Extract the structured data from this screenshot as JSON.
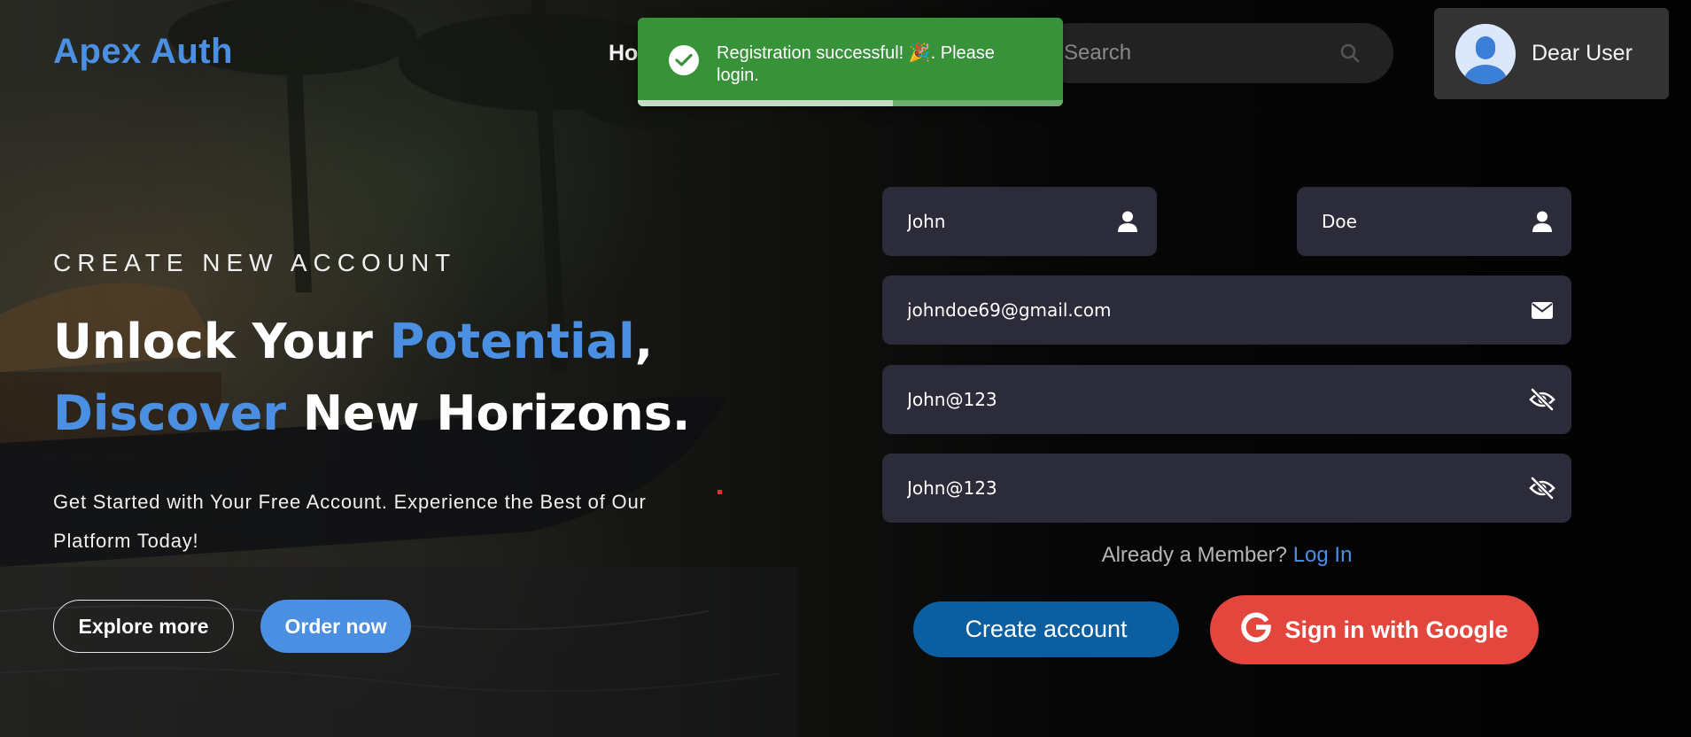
{
  "header": {
    "brand": "Apex Auth",
    "nav_home": "Ho",
    "search_placeholder": "Search",
    "user_name": "Dear User"
  },
  "toast": {
    "message": "Registration successful! 🎉. Please login.",
    "type": "success",
    "color": "#37923a",
    "progress": 0.6
  },
  "hero": {
    "eyebrow": "CREATE NEW ACCOUNT",
    "headline": {
      "line1_a": "Unlock Your ",
      "line1_accent": "Potential",
      "line1_b": ",",
      "line2_accent": "Discover",
      "line2_b": " New Horizons."
    },
    "subtitle": "Get Started with Your Free Account. Experience the Best of Our Platform Today!",
    "explore_label": "Explore more",
    "order_label": "Order now"
  },
  "form": {
    "first_name": {
      "value": "John",
      "icon": "user-icon"
    },
    "last_name": {
      "value": "Doe",
      "icon": "user-icon"
    },
    "email": {
      "value": "johndoe69@gmail.com",
      "icon": "envelope-icon"
    },
    "password": {
      "value": "John@123",
      "icon": "eye-slash-icon"
    },
    "confirm_password": {
      "value": "John@123",
      "icon": "eye-slash-icon"
    },
    "member_prompt": "Already a Member?",
    "login_link": "Log In",
    "create_label": "Create account",
    "google_label": "Sign in with Google"
  },
  "colors": {
    "accent": "#4a8fe2",
    "field_bg": "#2c2b39",
    "create_button": "#0b5ea0",
    "google_button": "#e2463d"
  }
}
